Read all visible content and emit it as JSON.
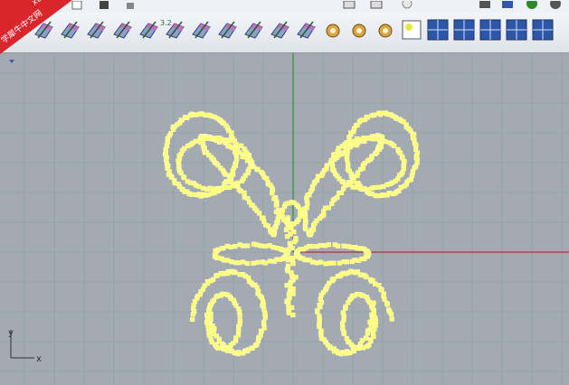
{
  "watermark": {
    "line1": "xuexiniu",
    "line2": "学犀牛中文网"
  },
  "viewport": {
    "axis_labels": {
      "x": "x",
      "y": "y"
    }
  },
  "toolbar": {
    "row_badges": [
      "3.2"
    ],
    "icons": [
      "viewport-shade-icon",
      "viewport-render-icon",
      "viewport-ghost-icon",
      "viewport-xray-icon",
      "viewport-tech-icon",
      "viewport-artistic-icon",
      "viewport-pen-icon",
      "viewport-arctic-icon",
      "viewport-raytrace-icon",
      "render-settings-icon",
      "render-gear-icon",
      "render-gear2-icon",
      "render-gear3-icon",
      "light-icon",
      "materials-icon",
      "layout-single-icon",
      "layout-quad-icon",
      "layout-grid-icon",
      "layout-split-icon",
      "layout-mixed-icon"
    ]
  },
  "colors": {
    "background": "#a3aab2",
    "grid": "#97a0a8",
    "axis_x": "#9a3a3a",
    "axis_y": "#2f8f3a",
    "points": "#ffff66",
    "points_glow": "#ffffb0"
  }
}
